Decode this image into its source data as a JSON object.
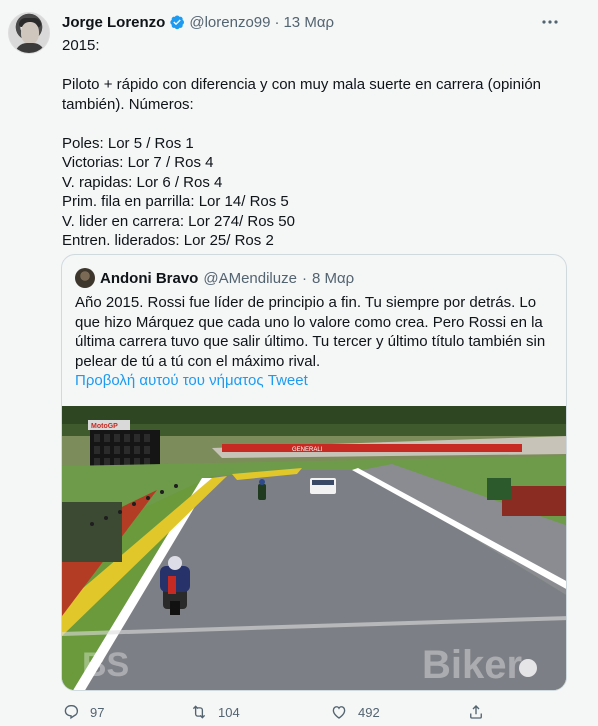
{
  "tweet": {
    "author_name": "Jorge Lorenzo",
    "handle": "@lorenzo99",
    "separator": "·",
    "date": "13 Μαρ",
    "more_label": "···",
    "lines": [
      "2015:",
      "",
      "Piloto + rápido con diferencia y con muy mala suerte en carrera (opinión",
      "también). Números:",
      "",
      "Poles: Lor 5 / Ros 1",
      "Victorias: Lor 7 / Ros 4",
      "V. rapidas: Lor 6 / Ros 4",
      "Prim. fila en parrilla: Lor 14/ Ros 5",
      "V. lider en carrera: Lor 274/ Ros 50",
      "Entren. liderados: Lor 25/ Ros 2"
    ]
  },
  "quoted": {
    "author_name": "Andoni Bravo",
    "handle": "@AMendiluze",
    "separator": "·",
    "date": "8 Μαρ",
    "lines": [
      "Año 2015. Rossi fue líder de principio a fin. Tu siempre por detrás. Lo",
      "que hizo Márquez que cada uno lo valore como crea. Pero Rossi en la",
      "última carrera tuvo que salir último. Tu tercer y último título también sin",
      "pelear de tú a tú con el máximo rival."
    ],
    "show_thread_label": "Προβολή αυτού του νήματος Tweet",
    "image": {
      "scoreboard_text": "MotoGP",
      "ad_text": "GENERALI"
    }
  },
  "watermarks": {
    "left": "BS",
    "right": "Biker"
  },
  "actions": {
    "reply_count": "97",
    "retweet_count": "104",
    "like_count": "492"
  },
  "colors": {
    "accent": "#1d9bf0",
    "secondary_text": "#536471",
    "background": "#f5f6f6"
  },
  "icons": [
    "verified-badge-icon",
    "more-icon",
    "reply-icon",
    "retweet-icon",
    "like-icon",
    "share-icon"
  ]
}
